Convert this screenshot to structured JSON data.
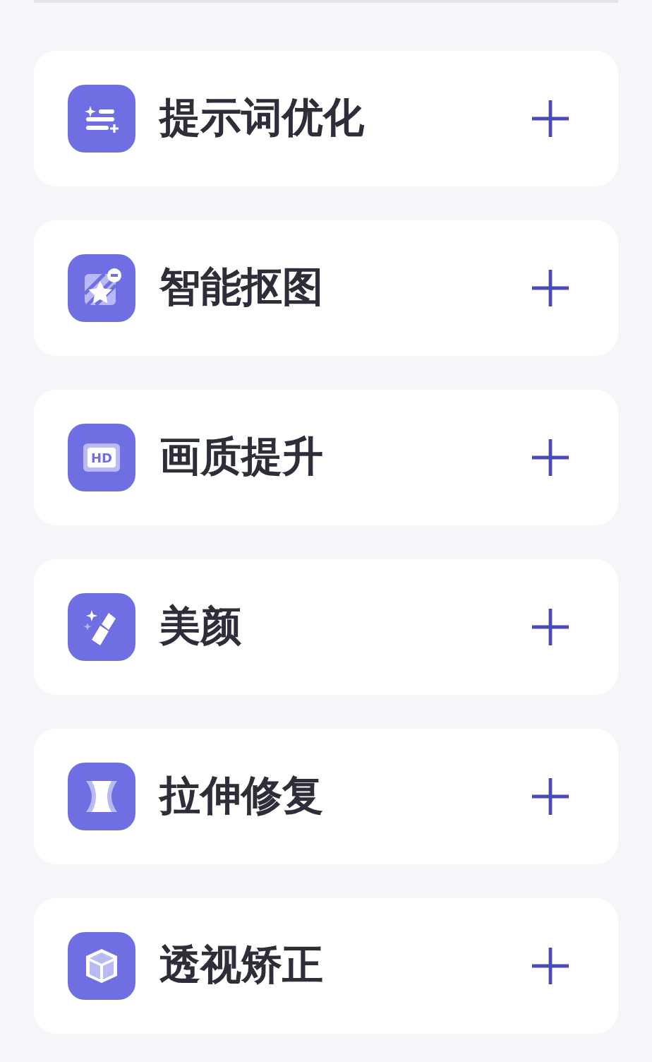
{
  "tools": [
    {
      "label": "提示词优化"
    },
    {
      "label": "智能抠图"
    },
    {
      "label": "画质提升",
      "icon_text": "HD"
    },
    {
      "label": "美颜"
    },
    {
      "label": "拉伸修复"
    },
    {
      "label": "透视矫正"
    }
  ]
}
